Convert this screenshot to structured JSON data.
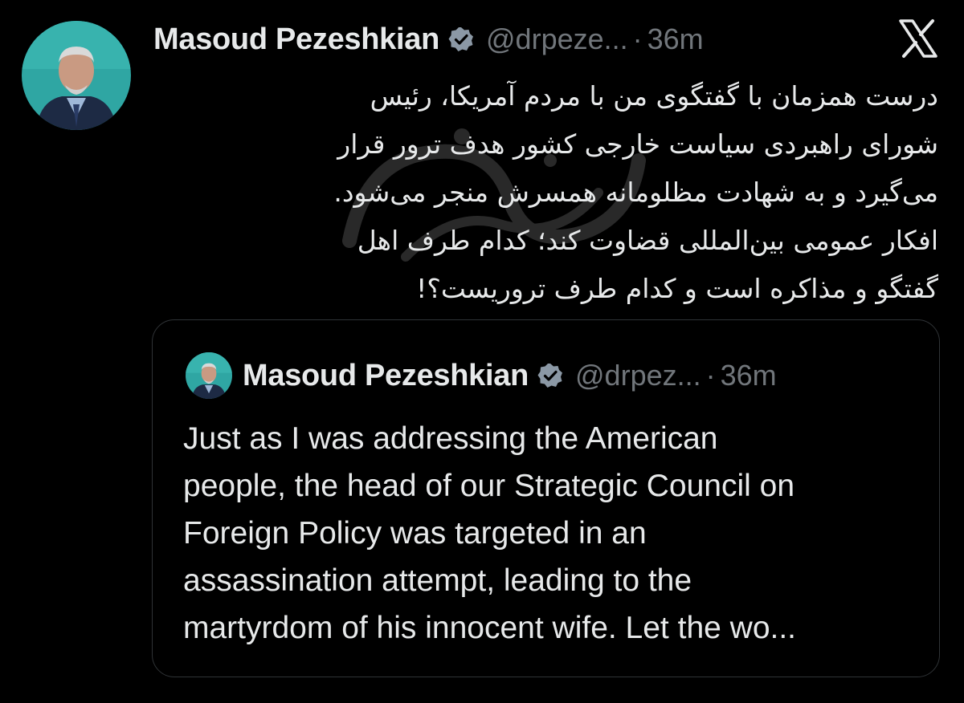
{
  "tweet": {
    "author_name": "Masoud Pezeshkian",
    "handle": "@drpeze...",
    "separator": "·",
    "time": "36m",
    "verified_icon": "verified-badge-icon",
    "platform_icon": "x-logo-icon",
    "text_lines": [
      "درست همزمان با گفتگوی من با مردم آمریکا، رئیس",
      "شورای راهبردی سیاست خارجی کشور هدف ترور قرار",
      "می‌گیرد و به شهادت مظلومانه همسرش منجر می‌شود.",
      "افکار عمومی بین‌المللی قضاوت کند؛ کدام طرف اهل",
      "گفتگو و مذاکره است و کدام طرف تروریست؟!"
    ]
  },
  "quoted_tweet": {
    "author_name": "Masoud Pezeshkian",
    "handle": "@drpez...",
    "separator": "·",
    "time": "36m",
    "text_lines": [
      "Just as I was addressing the American",
      "people, the head of our Strategic Council on",
      "Foreign Policy was targeted in an",
      "assassination attempt, leading to the",
      "martyrdom of his innocent wife. Let the wo..."
    ]
  },
  "colors": {
    "background": "#000000",
    "primary_text": "#e7e9ea",
    "secondary_text": "#71767b",
    "border": "#2f3336",
    "avatar_bg": "#2fa6a3"
  }
}
